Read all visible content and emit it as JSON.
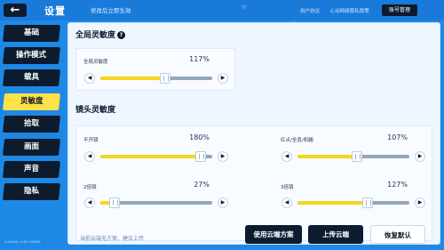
{
  "header": {
    "back_icon": "arrow-left-icon",
    "title": "设置",
    "notice": "修改后立即生效",
    "links": [
      "用户协议",
      "心动网络隐私政策"
    ],
    "account_button": "账号管理"
  },
  "sidebar": {
    "tabs": [
      {
        "label": "基础",
        "active": false
      },
      {
        "label": "操作模式",
        "active": false
      },
      {
        "label": "载具",
        "active": false
      },
      {
        "label": "灵敏度",
        "active": true
      },
      {
        "label": "拾取",
        "active": false
      },
      {
        "label": "画面",
        "active": false
      },
      {
        "label": "声音",
        "active": false
      },
      {
        "label": "隐私",
        "active": false
      }
    ],
    "version": "1.c0fa2b | 0.81 100001"
  },
  "global_section": {
    "title": "全局灵敏度",
    "help_icon": "question-icon",
    "slider": {
      "label": "全局灵敏度",
      "value_text": "117%",
      "level": 0.58
    }
  },
  "camera_section": {
    "title": "镜头灵敏度",
    "sliders": [
      {
        "label": "不开镜",
        "value_text": "180%",
        "level": 0.9
      },
      {
        "label": "红点/全息/机瞄",
        "value_text": "107%",
        "level": 0.53
      },
      {
        "label": "2倍镜",
        "value_text": "27%",
        "level": 0.13
      },
      {
        "label": "3倍镜",
        "value_text": "127%",
        "level": 0.63
      }
    ]
  },
  "stepper_icons": {
    "decrease": "triangle-left-icon",
    "increase": "triangle-right-icon"
  },
  "footer": {
    "cloud_status": "当前云端无方案，建议上传",
    "use_cloud": "使用云端方案",
    "upload_cloud": "上传云端",
    "restore_default": "恢复默认"
  },
  "colors": {
    "accent": "#ffe14a",
    "dark": "#0d1b2e",
    "background": "#1e88e5",
    "fill": "#f7d51c"
  }
}
